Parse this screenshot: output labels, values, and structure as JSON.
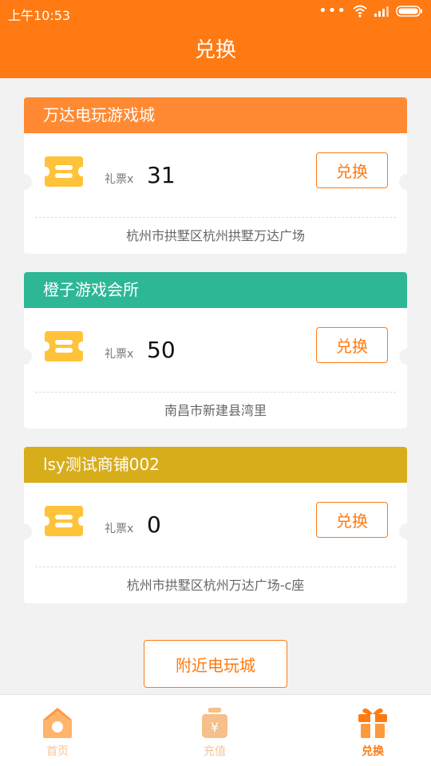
{
  "status_bar": {
    "time": "上午10:53",
    "dots": "•••"
  },
  "header": {
    "title": "兑换"
  },
  "colors": {
    "accent": "#ff7a12",
    "card1_head": "#ff8a33",
    "card2_head": "#2db795",
    "card3_head": "#d8ad1c",
    "ticket_icon": "#ffc33a"
  },
  "ticket_label": "礼票x",
  "exchange_label": "兑换",
  "stores": [
    {
      "name": "万达电玩游戏城",
      "count": "31",
      "address": "杭州市拱墅区杭州拱墅万达广场"
    },
    {
      "name": "橙子游戏会所",
      "count": "50",
      "address": "南昌市新建县湾里"
    },
    {
      "name": "lsy测试商铺002",
      "count": "0",
      "address": "杭州市拱墅区杭州万达广场-c座"
    }
  ],
  "nearby_button": "附近电玩城",
  "tabs": [
    {
      "label": "首页",
      "icon": "home-icon"
    },
    {
      "label": "充值",
      "icon": "recharge-icon"
    },
    {
      "label": "兑换",
      "icon": "gift-icon"
    }
  ]
}
